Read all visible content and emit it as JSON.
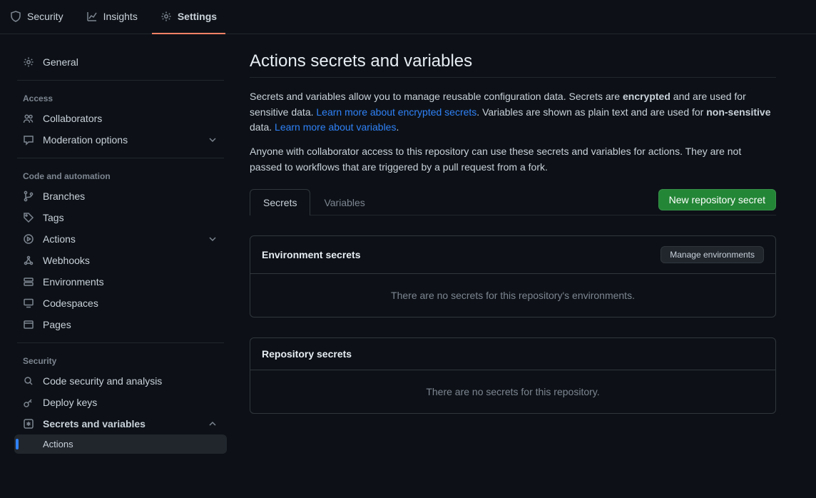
{
  "topnav": {
    "security": "Security",
    "insights": "Insights",
    "settings": "Settings"
  },
  "sidebar": {
    "general": "General",
    "groups": {
      "access": "Access",
      "code": "Code and automation",
      "security": "Security"
    },
    "access": {
      "collaborators": "Collaborators",
      "moderation": "Moderation options"
    },
    "code": {
      "branches": "Branches",
      "tags": "Tags",
      "actions": "Actions",
      "webhooks": "Webhooks",
      "environments": "Environments",
      "codespaces": "Codespaces",
      "pages": "Pages"
    },
    "security": {
      "analysis": "Code security and analysis",
      "deploy": "Deploy keys",
      "secrets": "Secrets and variables",
      "sub_actions": "Actions"
    }
  },
  "main": {
    "title": "Actions secrets and variables",
    "p1_a": "Secrets and variables allow you to manage reusable configuration data. Secrets are ",
    "p1_b": "encrypted",
    "p1_c": " and are used for sensitive data. ",
    "link1": "Learn more about encrypted secrets",
    "p1_d": ". Variables are shown as plain text and are used for ",
    "p1_e": "non-sensitive",
    "p1_f": " data. ",
    "link2": "Learn more about variables",
    "p1_g": ".",
    "p2": "Anyone with collaborator access to this repository can use these secrets and variables for actions. They are not passed to workflows that are triggered by a pull request from a fork.",
    "tabs": {
      "secrets": "Secrets",
      "variables": "Variables"
    },
    "new_secret_btn": "New repository secret",
    "env": {
      "title": "Environment secrets",
      "manage_btn": "Manage environments",
      "empty": "There are no secrets for this repository's environments."
    },
    "repo": {
      "title": "Repository secrets",
      "empty": "There are no secrets for this repository."
    }
  }
}
